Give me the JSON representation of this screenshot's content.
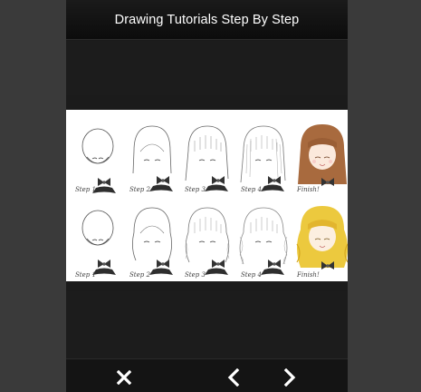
{
  "header": {
    "title": "Drawing Tutorials Step By Step"
  },
  "tutorial_image": {
    "rows": [
      {
        "labels": [
          "Step 1",
          "Step 2",
          "Step 3",
          "Step 4",
          "Finish!"
        ],
        "finish_hair_color": "#a86a3e"
      },
      {
        "labels": [
          "Step 1",
          "Step 2",
          "Step 3",
          "Step 4",
          "Finish!"
        ],
        "finish_hair_color": "#ecc93e"
      }
    ]
  },
  "toolbar": {
    "close_icon": "close-icon",
    "prev_icon": "chevron-left-icon",
    "next_icon": "chevron-right-icon"
  },
  "colors": {
    "background": "#363636",
    "app": "#1b1b1b",
    "title_text": "#ffffff"
  }
}
